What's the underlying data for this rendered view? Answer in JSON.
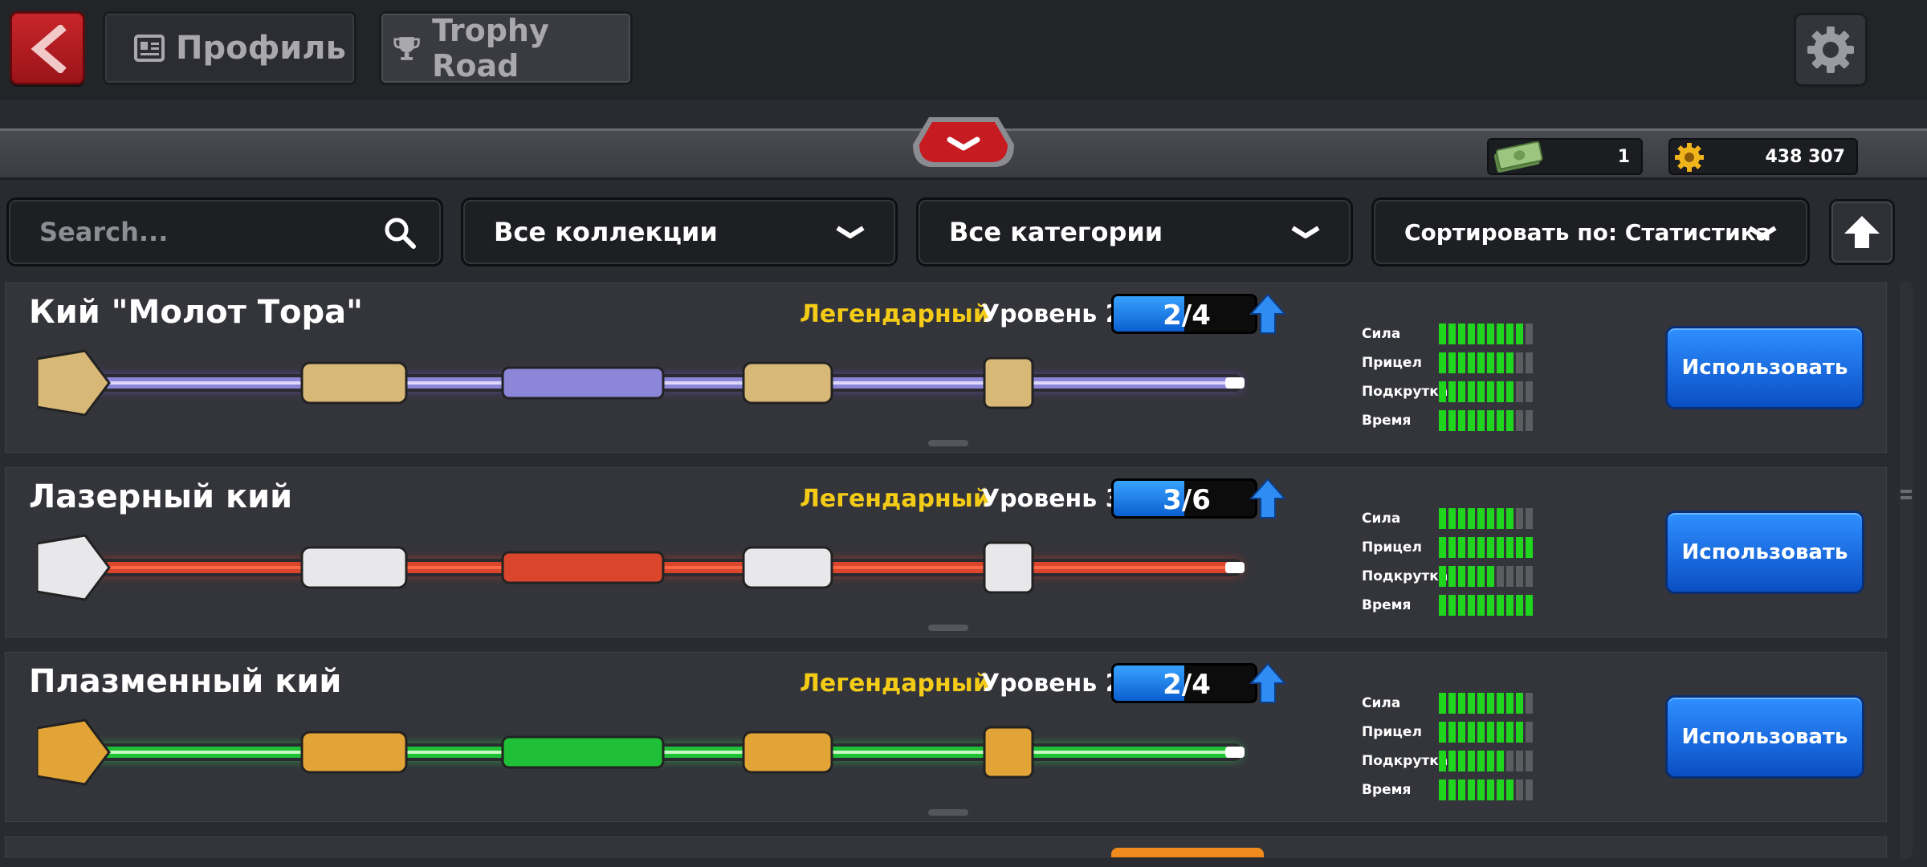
{
  "header": {
    "profile_label": "Профиль",
    "trophy_label": "Trophy Road"
  },
  "currency": {
    "cash": "1",
    "coins": "438 307"
  },
  "filters": {
    "search_placeholder": "Search...",
    "collections": "Все коллекции",
    "categories": "Все категории",
    "sort": "Сортировать по: Статистика"
  },
  "stat_labels": [
    "Сила",
    "Прицел",
    "Подкрутка",
    "Время"
  ],
  "cues": [
    {
      "name": "Кий \"Молот Тора\"",
      "rarity": "Легендарный",
      "level": "Уровень 2",
      "progress_text": "2/4",
      "progress": 0.5,
      "stats": [
        9,
        8,
        8,
        8
      ],
      "button": "Использовать",
      "theme": "thor"
    },
    {
      "name": "Лазерный кий",
      "rarity": "Легендарный",
      "level": "Уровень 3",
      "progress_text": "3/6",
      "progress": 0.5,
      "stats": [
        8,
        10,
        6,
        10
      ],
      "button": "Использовать",
      "theme": "laser"
    },
    {
      "name": "Плазменный кий",
      "rarity": "Легендарный",
      "level": "Уровень 2",
      "progress_text": "2/4",
      "progress": 0.5,
      "stats": [
        9,
        9,
        7,
        8
      ],
      "button": "Использовать",
      "theme": "plasma"
    }
  ],
  "colors": {
    "rarity": "#f4cc17",
    "stat_on": "#1fd51d",
    "stat_off": "#5c5d61",
    "button": "#1a6fe8"
  }
}
